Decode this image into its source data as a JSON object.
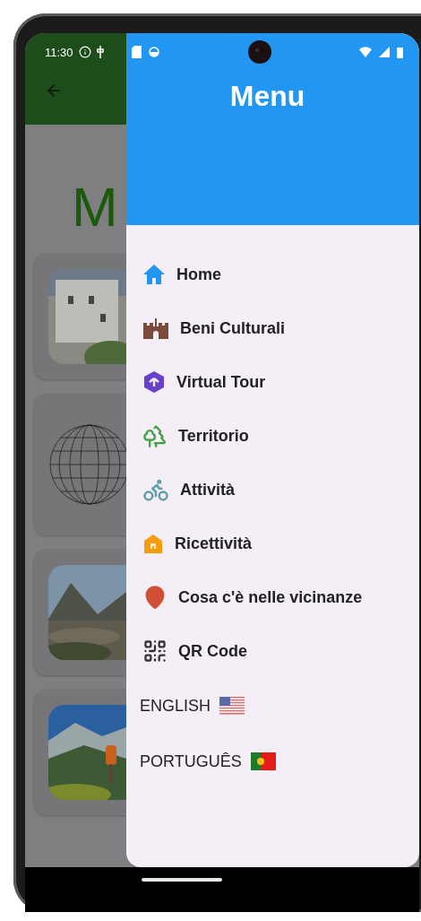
{
  "status_bar": {
    "time": "11:30"
  },
  "background_screen": {
    "title": "M",
    "cards": [
      {
        "kind": "picture"
      },
      {
        "kind": "globe"
      },
      {
        "kind": "picture"
      },
      {
        "kind": "picture"
      }
    ]
  },
  "drawer": {
    "title": "Menu",
    "items": [
      {
        "label": "Home"
      },
      {
        "label": "Beni Culturali"
      },
      {
        "label": "Virtual Tour"
      },
      {
        "label": "Territorio"
      },
      {
        "label": "Attività"
      },
      {
        "label": "Ricettività"
      },
      {
        "label": "Cosa c'è nelle vicinanze"
      },
      {
        "label": "QR Code"
      }
    ],
    "languages": [
      {
        "label": "ENGLISH"
      },
      {
        "label": "PORTUGUÊS"
      }
    ]
  }
}
